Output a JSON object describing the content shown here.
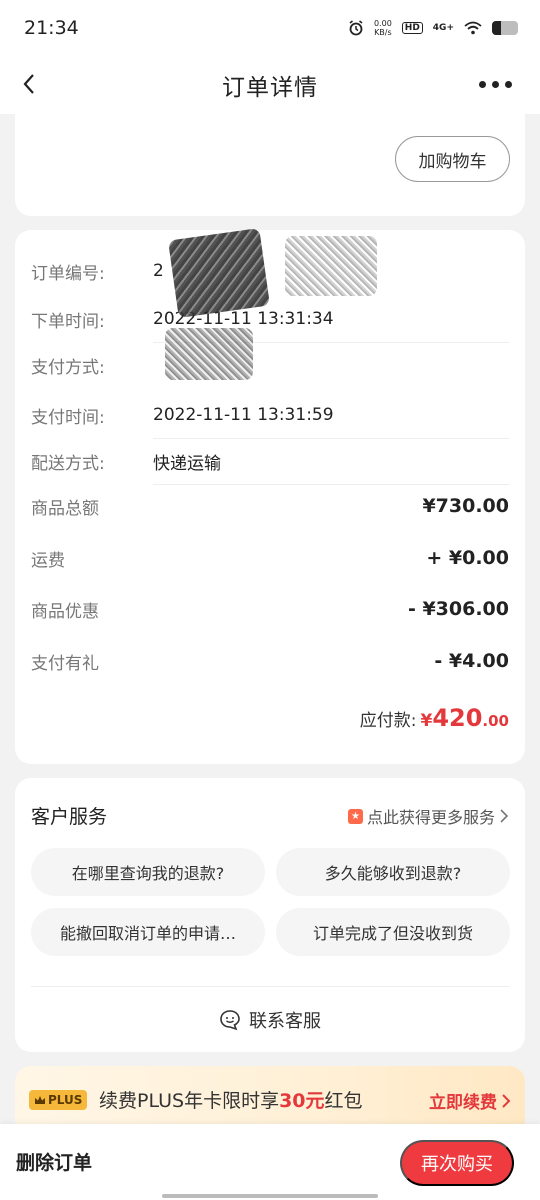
{
  "status_bar": {
    "time": "21:34",
    "net_speed_value": "0.00",
    "net_speed_unit": "KB/s",
    "hd": "HD",
    "network": "4G+",
    "icons": [
      "alarm-icon",
      "wifi-icon",
      "battery-icon"
    ]
  },
  "header": {
    "title": "订单详情"
  },
  "product_card": {
    "add_cart_label": "加购物车"
  },
  "order_info": {
    "rows": [
      {
        "label": "订单编号:",
        "value": "2"
      },
      {
        "label": "下单时间:",
        "value": "2022-11-11 13:31:34"
      },
      {
        "label": "支付方式:",
        "value": ""
      },
      {
        "label": "支付时间:",
        "value": "2022-11-11 13:31:59"
      },
      {
        "label": "配送方式:",
        "value": "快递运输"
      }
    ],
    "amounts": [
      {
        "label": "商品总额",
        "value": "¥730.00"
      },
      {
        "label": "运费",
        "value": "+ ¥0.00"
      },
      {
        "label": "商品优惠",
        "value": "- ¥306.00"
      },
      {
        "label": "支付有礼",
        "value": "- ¥4.00"
      }
    ],
    "payable_label": "应付款:",
    "payable_currency": "¥",
    "payable_integer": "420",
    "payable_decimal": ".00"
  },
  "customer_service": {
    "title": "客户服务",
    "more_label": "点此获得更多服务",
    "questions": [
      "在哪里查询我的退款?",
      "多久能够收到退款?",
      "能撤回取消订单的申请…",
      "订单完成了但没收到货"
    ],
    "contact_label": "联系客服"
  },
  "plus_promo": {
    "badge": "PLUS",
    "text_prefix": "续费PLUS年卡限时享",
    "text_highlight": "30元",
    "text_suffix": "红包",
    "renew_label": "立即续费"
  },
  "bottom_bar": {
    "delete_label": "删除订单",
    "rebuy_label": "再次购买"
  },
  "colors": {
    "accent_red": "#e4393c",
    "button_red": "#ef3b3f",
    "plus_gold": "#f6b83a"
  }
}
